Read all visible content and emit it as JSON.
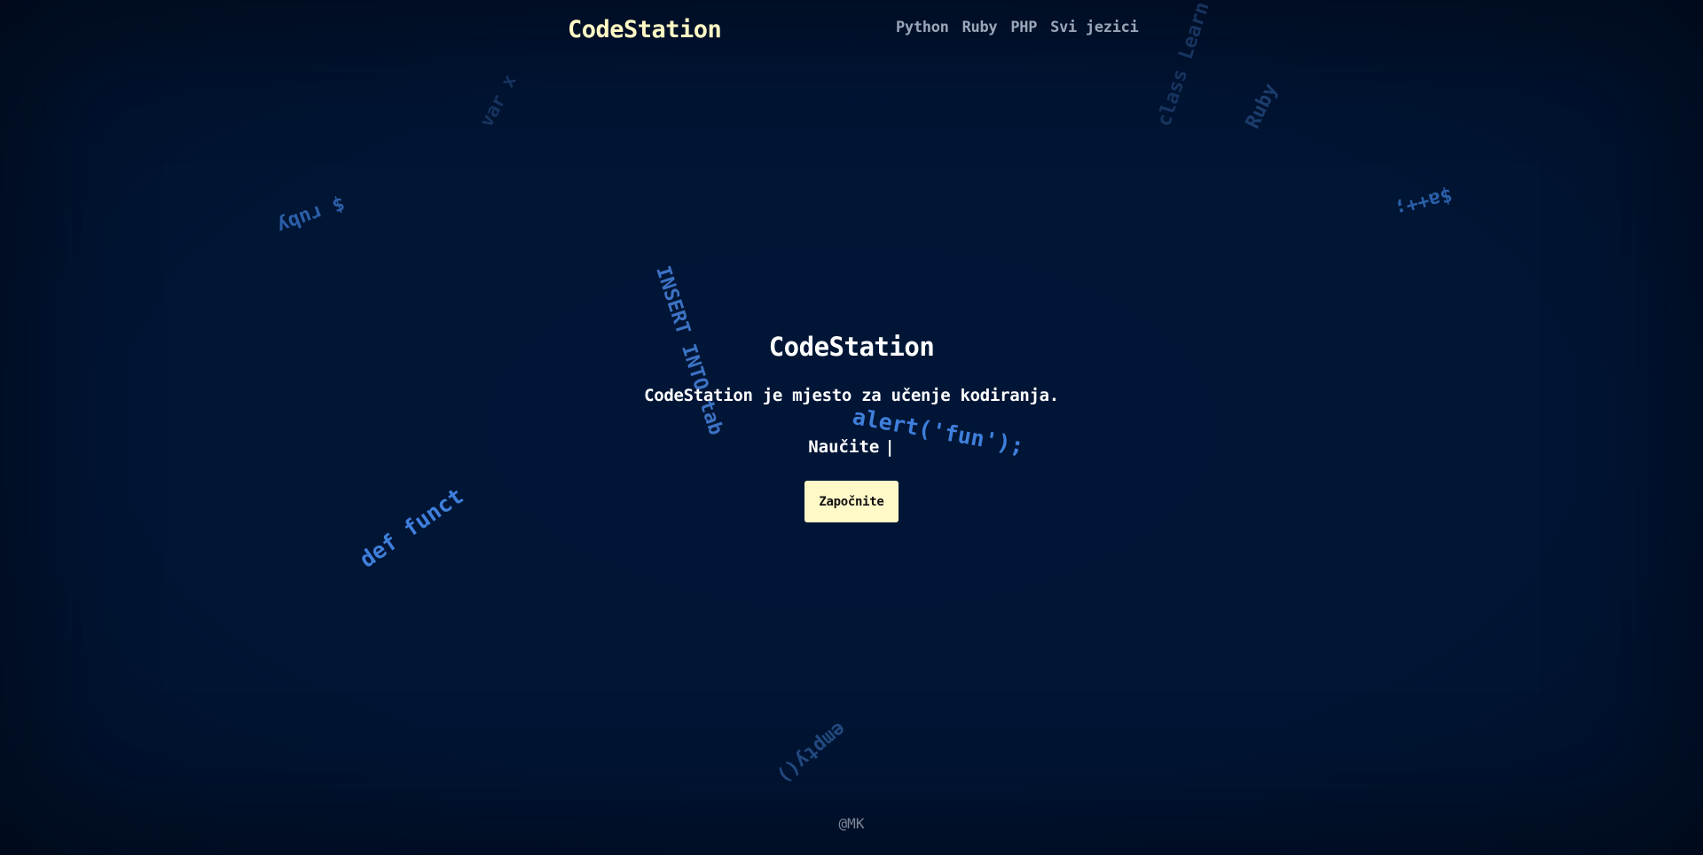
{
  "header": {
    "logo": "CodeStation",
    "nav": [
      {
        "label": "Python"
      },
      {
        "label": "Ruby"
      },
      {
        "label": "PHP"
      },
      {
        "label": "Svi jezici"
      }
    ]
  },
  "floating_words": {
    "var_x": "var x",
    "class_learn": "class Learn",
    "ruby": "Ruby",
    "dollar_ruby": "$ ruby",
    "dollar_a": "$a++;",
    "insert_into": "INSERT INTO tab",
    "alert": "alert('fun');",
    "def_funct": "def funct",
    "empty": "empty()"
  },
  "hero": {
    "title": "CodeStation",
    "subtitle": "CodeStation je mjesto za učenje kodiranja.",
    "typing_prefix": "Naučite",
    "cursor": "|",
    "cta_label": "Započnite"
  },
  "footer": {
    "text": "@MK"
  },
  "colors": {
    "background": "#011534",
    "logo": "#fff8c4",
    "button_bg": "#fff9c8",
    "nav_text": "#9aa6b8",
    "code_blue": "#3f7fdc"
  }
}
